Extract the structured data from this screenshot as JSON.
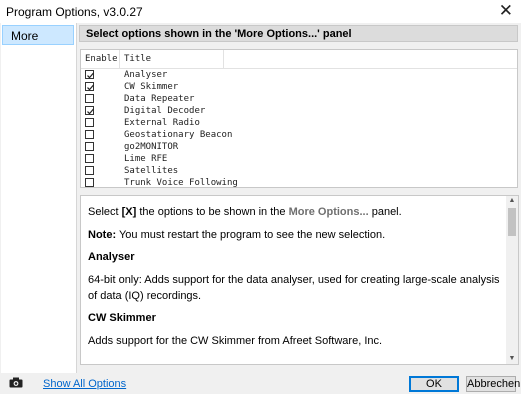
{
  "window": {
    "title": "Program Options, v3.0.27",
    "close_glyph": "✕"
  },
  "sidebar": {
    "items": [
      {
        "label": "More",
        "selected": true
      }
    ]
  },
  "panel": {
    "header": "Select options shown in the 'More Options...' panel"
  },
  "grid": {
    "columns": [
      "Enable",
      "Title"
    ],
    "rows": [
      {
        "title": "Analyser",
        "checked": true
      },
      {
        "title": "CW Skimmer",
        "checked": true
      },
      {
        "title": "Data Repeater",
        "checked": false
      },
      {
        "title": "Digital Decoder",
        "checked": true
      },
      {
        "title": "External Radio",
        "checked": false
      },
      {
        "title": "Geostationary Beacon",
        "checked": false
      },
      {
        "title": "go2MONITOR",
        "checked": false
      },
      {
        "title": "Lime RFE",
        "checked": false
      },
      {
        "title": "Satellites",
        "checked": false
      },
      {
        "title": "Trunk Voice Following",
        "checked": false
      }
    ]
  },
  "description": {
    "line1_pre": "Select ",
    "line1_x": "[X]",
    "line1_mid": " the options to be shown in the ",
    "line1_more": "More Options...",
    "line1_post": " panel.",
    "note_label": "Note:",
    "note_text": " You must restart the program to see the new selection.",
    "analyser_heading": "Analyser",
    "analyser_text": "64-bit only: Adds support for the data analyser, used for creating large-scale analysis of data (IQ) recordings.",
    "cw_heading": "CW Skimmer",
    "cw_text": "Adds support for the CW Skimmer from Afreet Software, Inc."
  },
  "footer": {
    "camera_icon": "camera-icon",
    "show_all_label": "Show All Options",
    "ok_label": "OK",
    "cancel_label": "Abbrechen"
  },
  "colors": {
    "accent": "#0078d7",
    "link": "#0066cc",
    "selection": "#cde8ff"
  }
}
